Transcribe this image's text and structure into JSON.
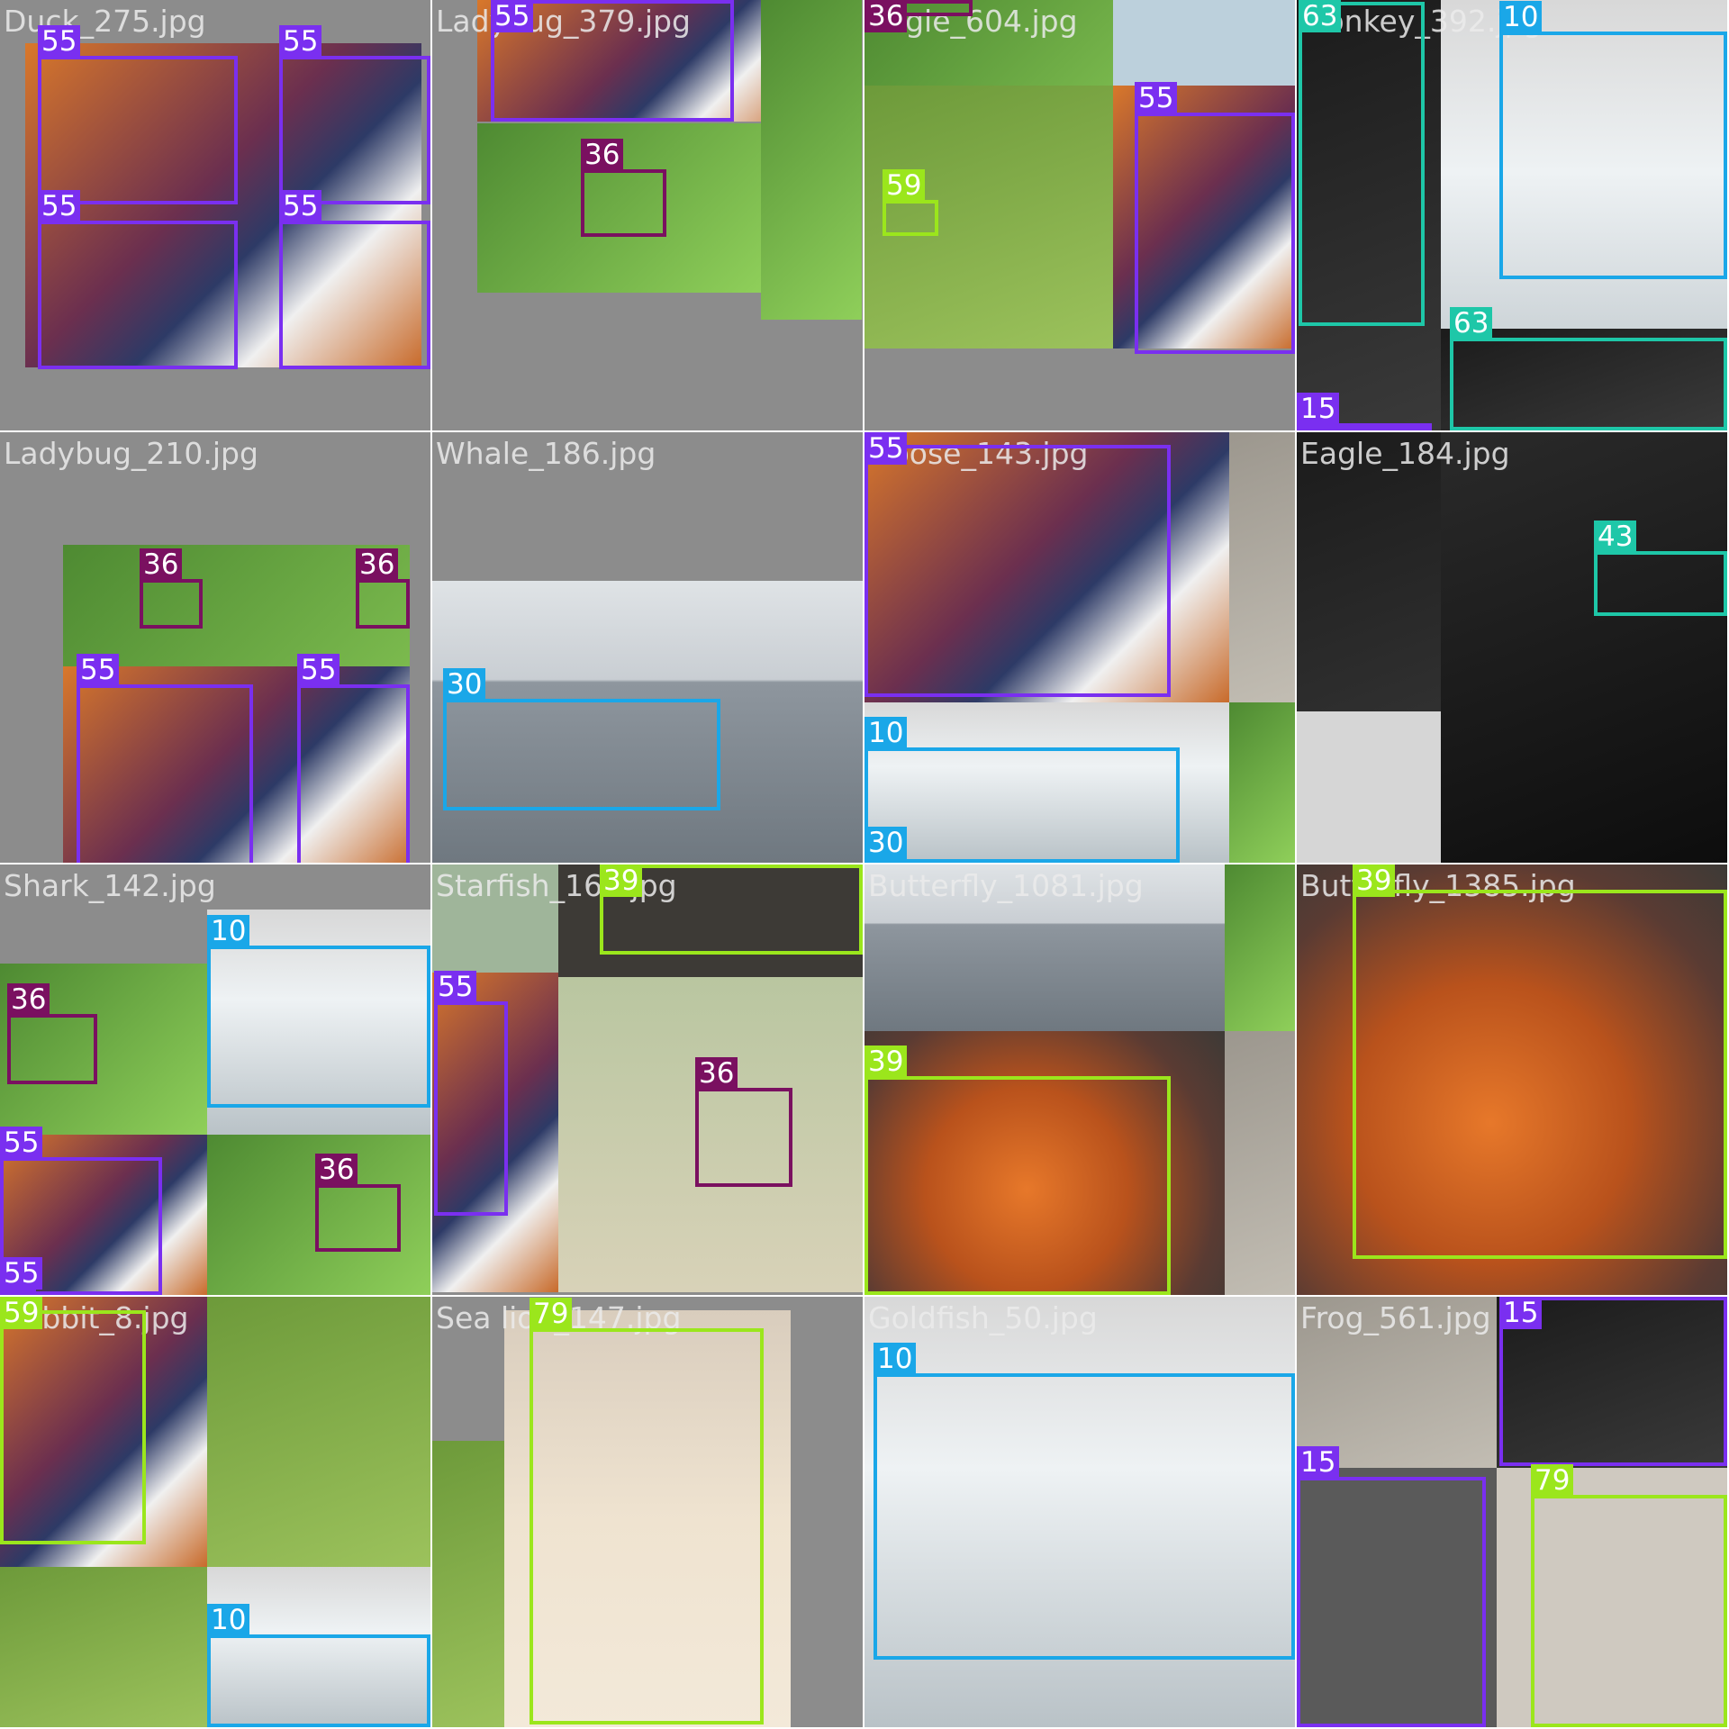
{
  "mosaic": {
    "class_colors": {
      "10": "#1aa7e8",
      "15": "#7a2ff0",
      "30": "#1aa7e8",
      "36": "#7a1060",
      "39": "#9be61c",
      "43": "#1ec7a8",
      "55": "#7a2ff0",
      "59": "#9be61c",
      "63": "#1ec7a8",
      "79": "#9be61c"
    },
    "tiles": [
      {
        "file": "Duck_275.jpg",
        "detections": [
          {
            "cls": "55"
          },
          {
            "cls": "55"
          },
          {
            "cls": "55"
          },
          {
            "cls": "55"
          }
        ]
      },
      {
        "file": "Ladybug_379.jpg",
        "detections": [
          {
            "cls": "55"
          },
          {
            "cls": "36"
          }
        ]
      },
      {
        "file": "Eagle_604.jpg",
        "detections": [
          {
            "cls": "36"
          },
          {
            "cls": "55"
          },
          {
            "cls": "59"
          }
        ]
      },
      {
        "file": "Monkey_392.jpg",
        "detections": [
          {
            "cls": "63"
          },
          {
            "cls": "10"
          },
          {
            "cls": "63"
          },
          {
            "cls": "15"
          }
        ]
      },
      {
        "file": "Ladybug_210.jpg",
        "detections": [
          {
            "cls": "36"
          },
          {
            "cls": "36"
          },
          {
            "cls": "55"
          },
          {
            "cls": "55"
          }
        ]
      },
      {
        "file": "Whale_186.jpg",
        "detections": [
          {
            "cls": "30"
          }
        ]
      },
      {
        "file": "Goose_143.jpg",
        "detections": [
          {
            "cls": "55"
          },
          {
            "cls": "10"
          },
          {
            "cls": "30"
          }
        ]
      },
      {
        "file": "Eagle_184.jpg",
        "detections": [
          {
            "cls": "43"
          }
        ]
      },
      {
        "file": "Shark_142.jpg",
        "detections": [
          {
            "cls": "10"
          },
          {
            "cls": "36"
          },
          {
            "cls": "55"
          },
          {
            "cls": "36"
          },
          {
            "cls": "55"
          }
        ]
      },
      {
        "file": "Starfish_164.jpg",
        "detections": [
          {
            "cls": "39"
          },
          {
            "cls": "55"
          },
          {
            "cls": "36"
          }
        ]
      },
      {
        "file": "Butterfly_1081.jpg",
        "detections": [
          {
            "cls": "39"
          }
        ]
      },
      {
        "file": "Butterfly_1385.jpg",
        "detections": [
          {
            "cls": "39"
          }
        ]
      },
      {
        "file": "Rabbit_8.jpg",
        "detections": [
          {
            "cls": "59"
          },
          {
            "cls": "10"
          }
        ]
      },
      {
        "file": "Sea lion_147.jpg",
        "detections": [
          {
            "cls": "79"
          }
        ]
      },
      {
        "file": "Goldfish_50.jpg",
        "detections": [
          {
            "cls": "10"
          }
        ]
      },
      {
        "file": "Frog_561.jpg",
        "detections": [
          {
            "cls": "15"
          },
          {
            "cls": "15"
          },
          {
            "cls": "79"
          }
        ]
      }
    ]
  }
}
